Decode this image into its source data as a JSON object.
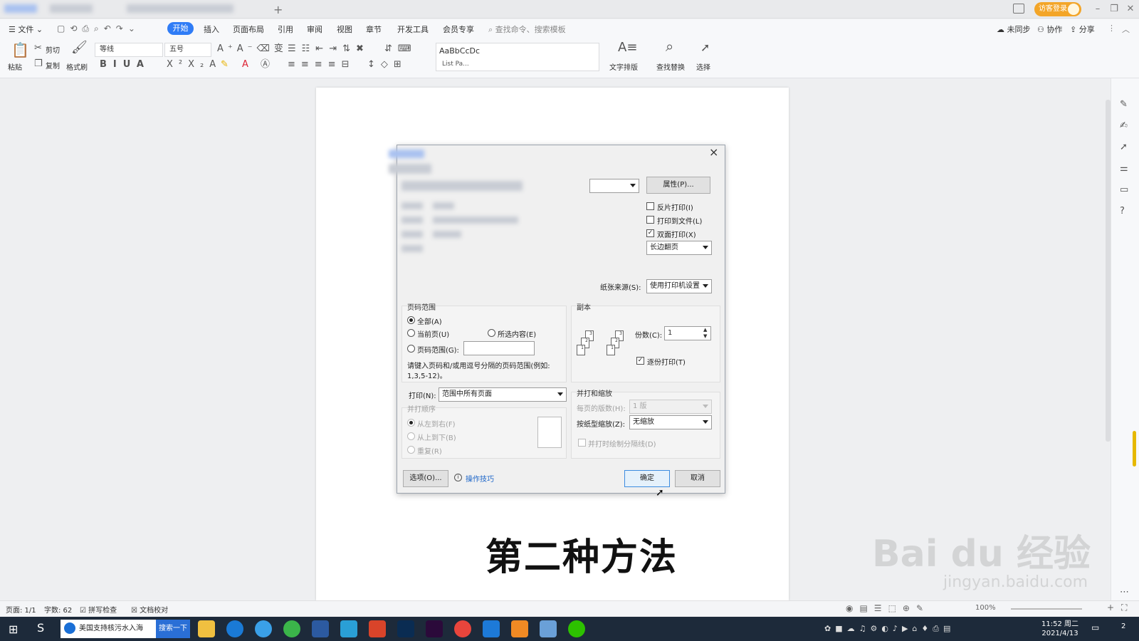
{
  "titlebar": {
    "login_label": "访客登录",
    "add_tab": "+"
  },
  "menubar": {
    "file": "文件",
    "tabs": [
      "开始",
      "插入",
      "页面布局",
      "引用",
      "审阅",
      "视图",
      "章节",
      "开发工具",
      "会员专享"
    ],
    "search_placeholder": "查找命令、搜索模板",
    "sync": "未同步",
    "collab": "协作",
    "share": "分享"
  },
  "ribbon": {
    "paste": "粘贴",
    "cut": "剪切",
    "copy": "复制",
    "format_painter": "格式刷",
    "font_name": "等线",
    "font_size": "五号",
    "style_preview": "AaBbCcDc",
    "style_name": "List Pa...",
    "text_layout": "文字排版",
    "find_replace": "查找替换",
    "select": "选择"
  },
  "dialog": {
    "properties_button": "属性(P)...",
    "reverse_print": "反片打印(I)",
    "print_to_file": "打印到文件(L)",
    "duplex_print": "双面打印(X)",
    "duplex_mode": "长边翻页",
    "paper_source_label": "纸张来源(S):",
    "paper_source_value": "使用打印机设置",
    "page_range_title": "页码范围",
    "all": "全部(A)",
    "current_page": "当前页(U)",
    "selection": "所选内容(E)",
    "page_range": "页码范围(G):",
    "range_hint": "请键入页码和/或用逗号分隔的页码范围(例如:",
    "range_example": "1,3,5-12)。",
    "print_label": "打印(N):",
    "print_value": "范围中所有页面",
    "order_title": "并打顺序",
    "left_to_right": "从左到右(F)",
    "top_to_bottom": "从上到下(B)",
    "repeat": "重复(R)",
    "copies_title": "副本",
    "copies_label": "份数(C):",
    "copies_value": "1",
    "collate": "逐份打印(T)",
    "scale_title": "并打和缩放",
    "pages_per_sheet_label": "每页的版数(H):",
    "pages_per_sheet_value": "1 版",
    "scale_label": "按纸型缩放(Z):",
    "scale_value": "无缩放",
    "draw_lines": "并打时绘制分隔线(D)",
    "options_button": "选项(O)...",
    "tips_link": "操作技巧",
    "ok_button": "确定",
    "cancel_button": "取消",
    "close": "×"
  },
  "overlay": {
    "title": "第二种方法"
  },
  "watermark": {
    "brand": "Bai du 经验",
    "url": "jingyan.baidu.com"
  },
  "statusbar": {
    "page": "页面: 1/1",
    "words": "字数: 62",
    "spell": "拼写检查",
    "proof": "文档校对",
    "zoom": "100%"
  },
  "taskbar": {
    "search_text": "美国支持核污水入海",
    "search_button": "搜索一下",
    "time": "11:52 周二",
    "date": "2021/4/13",
    "notifications": "2"
  },
  "colors": {
    "accent": "#2f7cf6",
    "login": "#f3a528",
    "taskbar": "#1d2a3a"
  }
}
